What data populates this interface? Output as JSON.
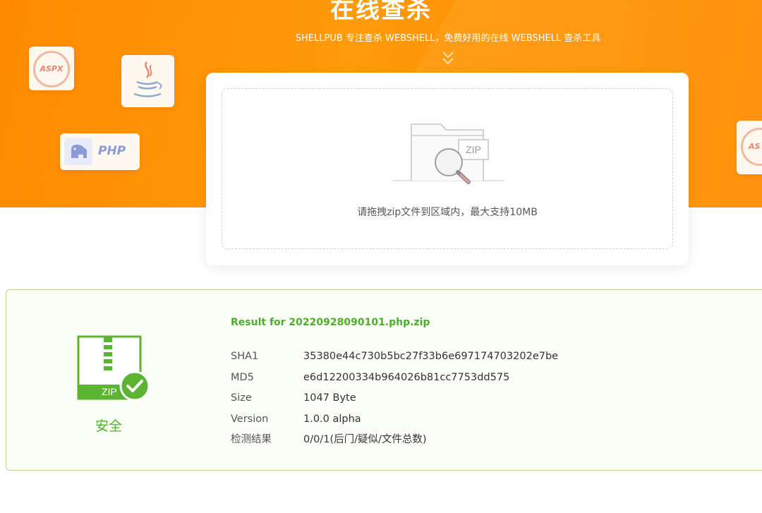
{
  "hero": {
    "title": "在线查杀",
    "subtitle": "SHELLPUB 专注查杀 WEBSHELL，免费好用的在线 WEBSHELL 查杀工具",
    "badges": [
      "ASPX",
      "PHP",
      "AS"
    ]
  },
  "upload": {
    "zip_label": "ZIP",
    "hint": "请拖拽zip文件到区域内，最大支持10MB"
  },
  "result": {
    "title": "Result for 20220928090101.php.zip",
    "icon_label": "ZIP",
    "status": "安全",
    "rows": [
      {
        "key": "SHA1",
        "value": "35380e44c730b5bc27f33b6e697174703202e7be"
      },
      {
        "key": "MD5",
        "value": "e6d12200334b964026b81cc7753dd575"
      },
      {
        "key": "Size",
        "value": "1047 Byte"
      },
      {
        "key": "Version",
        "value": "1.0.0 alpha"
      },
      {
        "key": "检测结果",
        "value": "0/0/1(后门/疑似/文件总数)"
      }
    ]
  },
  "colors": {
    "brand": "#ff8c00",
    "safe": "#4caf2a",
    "border_green": "#b5d98a"
  }
}
